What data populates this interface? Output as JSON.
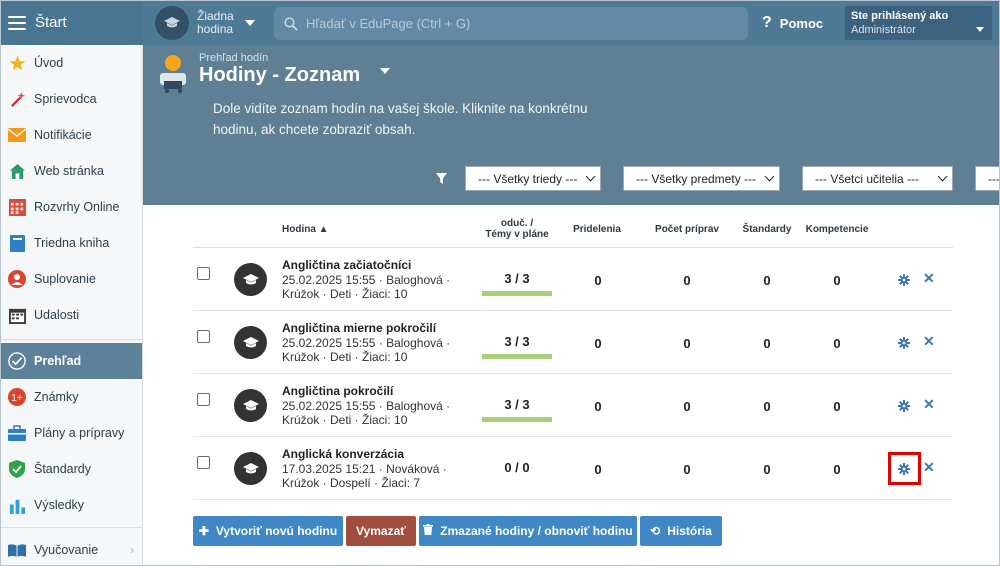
{
  "topbar": {
    "start_label": "Štart",
    "lesson_label": "Žiadna hodina",
    "search_placeholder": "Hľadať v EduPage (Ctrl + G)",
    "help_label": "Pomoc",
    "login_line1": "Ste prihlásený ako",
    "login_line2": "Administrátor"
  },
  "sidebar": {
    "items": [
      {
        "label": "Úvod",
        "icon": "star-icon"
      },
      {
        "label": "Sprievodca",
        "icon": "magic-wand-icon"
      },
      {
        "label": "Notifikácie",
        "icon": "envelope-icon"
      },
      {
        "label": "Web stránka",
        "icon": "home-icon"
      },
      {
        "label": "Rozvrhy Online",
        "icon": "calendar-grid-icon"
      },
      {
        "label": "Triedna kniha",
        "icon": "book-icon"
      },
      {
        "label": "Suplovanie",
        "icon": "user-icon"
      },
      {
        "label": "Udalosti",
        "icon": "calendar-icon"
      },
      {
        "label": "Prehľad",
        "icon": "check-circle-icon"
      },
      {
        "label": "Známky",
        "icon": "grade-icon"
      },
      {
        "label": "Plány a prípravy",
        "icon": "briefcase-icon"
      },
      {
        "label": "Štandardy",
        "icon": "shield-check-icon"
      },
      {
        "label": "Výsledky",
        "icon": "bar-chart-icon"
      },
      {
        "label": "Vyučovanie",
        "icon": "open-book-icon"
      }
    ]
  },
  "header": {
    "breadcrumb": "Prehľad hodín",
    "title": "Hodiny - Zoznam",
    "description": "Dole vidíte zoznam hodín na vašej škole. Kliknite na konkrétnu hodinu, ak chcete zobraziť obsah.",
    "filters": {
      "classes": "--- Všetky triedy ---",
      "subjects": "--- Všetky predmety ---",
      "teachers": "--- Všetci učitelia ---",
      "more": "---"
    }
  },
  "table": {
    "headers": {
      "lesson": "Hodina ▲",
      "taught_line1": "oduč. /",
      "taught_line2": "Témy v pláne",
      "assignments": "Pridelenia",
      "preparations": "Počet príprav",
      "standards": "Štandardy",
      "competences": "Kompetencie"
    },
    "rows": [
      {
        "name": "Angličtina začiatočníci",
        "info1": "25.02.2025 15:55 · Baloghová ·",
        "info2": "Krúžok · Deti · Žiaci: 10",
        "progress": "3 / 3",
        "progress_fraction": 1.0,
        "assignments": "0",
        "preparations": "0",
        "standards": "0",
        "competences": "0"
      },
      {
        "name": "Angličtina mierne pokročilí",
        "info1": "25.02.2025 15:55 · Baloghová ·",
        "info2": "Krúžok · Deti · Žiaci: 10",
        "progress": "3 / 3",
        "progress_fraction": 1.0,
        "assignments": "0",
        "preparations": "0",
        "standards": "0",
        "competences": "0"
      },
      {
        "name": "Angličtina pokročilí",
        "info1": "25.02.2025 15:55 · Baloghová ·",
        "info2": "Krúžok · Deti · Žiaci: 10",
        "progress": "3 / 3",
        "progress_fraction": 1.0,
        "assignments": "0",
        "preparations": "0",
        "standards": "0",
        "competences": "0"
      },
      {
        "name": "Anglická konverzácia",
        "info1": "17.03.2025 15:21 · Nováková ·",
        "info2": "Krúžok · Dospelí · Žiaci: 7",
        "progress": "0 / 0",
        "progress_fraction": 0,
        "assignments": "0",
        "preparations": "0",
        "standards": "0",
        "competences": "0"
      }
    ]
  },
  "buttons": {
    "create": "Vytvoriť novú hodinu",
    "delete": "Vymazať",
    "deleted": "Zmazané hodiny / obnoviť hodinu",
    "history": "História"
  },
  "colors": {
    "accent": "#4f7a96",
    "button_blue": "#3f88c5",
    "button_red": "#a14d40",
    "progress_fill": "#a9cf7a",
    "highlight": "#e10000"
  }
}
